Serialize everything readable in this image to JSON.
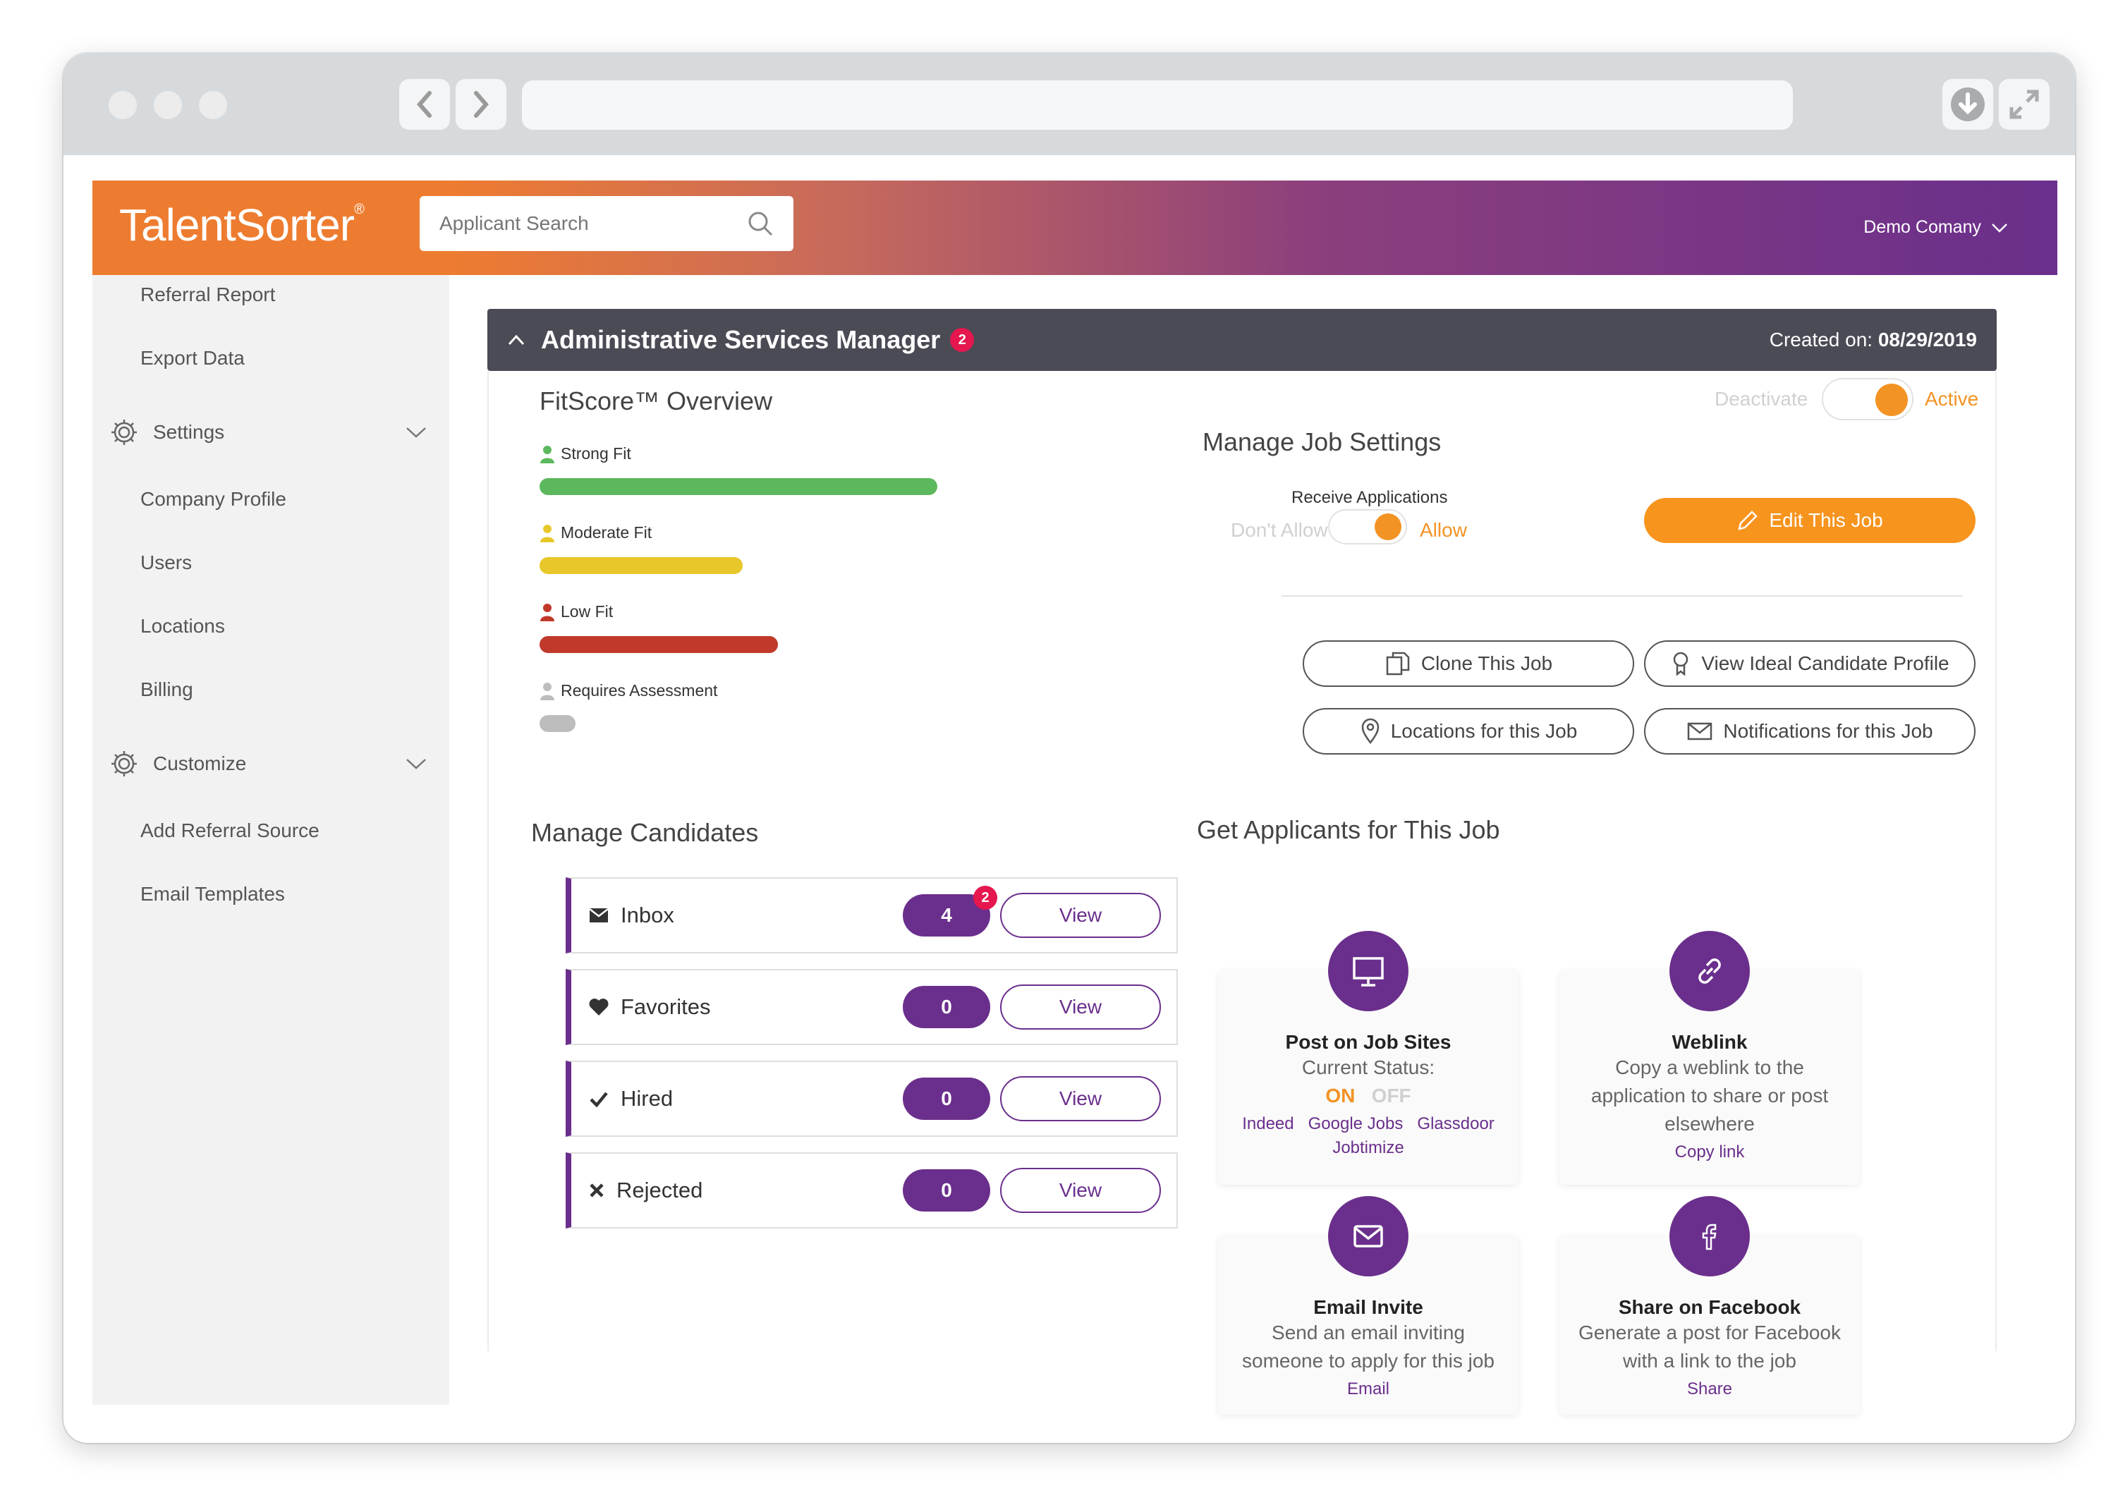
{
  "app": {
    "logo": "TalentSorter",
    "logo_mark": "®",
    "search_placeholder": "Applicant Search",
    "company": "Demo Comany"
  },
  "sidebar": {
    "items_top": [
      "Referral Report",
      "Export Data"
    ],
    "settings_label": "Settings",
    "settings_items": [
      "Company Profile",
      "Users",
      "Locations",
      "Billing"
    ],
    "customize_label": "Customize",
    "customize_items": [
      "Add Referral Source",
      "Email Templates"
    ]
  },
  "job": {
    "title": "Administrative Services Manager",
    "badge": "2",
    "created_label": "Created on:",
    "created_date": "08/29/2019"
  },
  "fitscore": {
    "title": "FitScore™ Overview",
    "items": [
      {
        "label": "Strong Fit",
        "color": "#5cb85c",
        "share": 1.0
      },
      {
        "label": "Moderate Fit",
        "color": "#e8c72a",
        "share": 0.51
      },
      {
        "label": "Low Fit",
        "color": "#c0392b",
        "share": 0.6
      },
      {
        "label": "Requires Assessment",
        "color": "#bdbdbd",
        "share": 0.09
      }
    ]
  },
  "status_toggle": {
    "off_label": "Deactivate",
    "on_label": "Active",
    "state": "on"
  },
  "job_settings": {
    "title": "Manage Job Settings",
    "receive_label": "Receive Applications",
    "dont_allow": "Don't Allow",
    "allow": "Allow",
    "edit_button": "Edit This Job",
    "buttons": {
      "clone": "Clone This Job",
      "ideal": "View Ideal Candidate Profile",
      "locations": "Locations for this Job",
      "notifications": "Notifications for this Job"
    }
  },
  "candidates": {
    "title": "Manage Candidates",
    "rows": [
      {
        "label": "Inbox",
        "count": "4",
        "badge": "2",
        "view": "View"
      },
      {
        "label": "Favorites",
        "count": "0",
        "view": "View"
      },
      {
        "label": "Hired",
        "count": "0",
        "view": "View"
      },
      {
        "label": "Rejected",
        "count": "0",
        "view": "View"
      }
    ]
  },
  "applicants": {
    "title": "Get Applicants for This Job",
    "post": {
      "title": "Post on Job Sites",
      "status_label": "Current Status:",
      "on": "ON",
      "off": "OFF",
      "sites": [
        "Indeed",
        "Google Jobs",
        "Glassdoor",
        "Jobtimize"
      ]
    },
    "weblink": {
      "title": "Weblink",
      "text": "Copy a weblink to the application to share or post elsewhere",
      "link": "Copy link"
    },
    "email": {
      "title": "Email Invite",
      "text": "Send an email inviting someone to apply for this job",
      "link": "Email"
    },
    "facebook": {
      "title": "Share on Facebook",
      "text": "Generate a post for Facebook with a link to the job",
      "link": "Share"
    }
  }
}
